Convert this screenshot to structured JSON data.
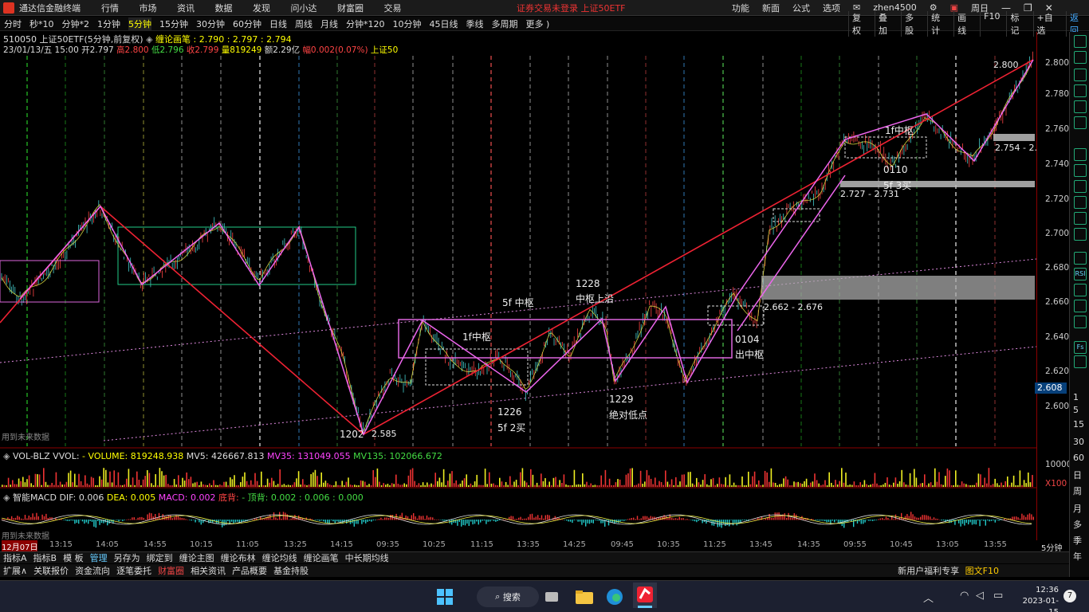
{
  "titlebar": {
    "app_name": "通达信金融终端",
    "menus": [
      "行情",
      "市场",
      "资讯",
      "数据",
      "发现",
      "问小达",
      "财富圈",
      "交易"
    ],
    "notice": "证券交易未登录  上证50ETF",
    "right_items": [
      "功能",
      "新面",
      "公式",
      "选项"
    ],
    "user": "zhen4500",
    "weekly": "周日"
  },
  "periods": [
    "分时",
    "秒*10",
    "分钟*2",
    "1分钟",
    "5分钟",
    "15分钟",
    "30分钟",
    "60分钟",
    "日线",
    "周线",
    "月线",
    "分钟*120",
    "10分钟",
    "45日线",
    "季线",
    "多周期",
    "更多 )"
  ],
  "active_period": "5分钟",
  "toolbar_right": [
    "复权",
    "叠加",
    "多股",
    "统计",
    "画线",
    "F10",
    "标记",
    "+自选",
    "返回"
  ],
  "info": {
    "line1_code": "510050 上证50ETF(5分钟,前复权)",
    "line1_indicator": "缠论画笔 : 2.790 : 2.797 : 2.794",
    "line2_date": "23/01/13/五 15:00",
    "line2_open": "开2.797",
    "line2_high": "高2.800",
    "line2_low": "低2.796",
    "line2_close": "收2.799",
    "line2_vol": "量819249",
    "line2_amt": "额2.29亿",
    "line2_chg": "幅0.002(0.07%)",
    "line2_idx": "上证50"
  },
  "annotations": {
    "a1": "1f中枢",
    "a2": "5f 中枢",
    "a3": "1228",
    "a4": "中枢上沿",
    "a5": "1226",
    "a6": "5f 2买",
    "a7": "1229",
    "a8": "绝对低点",
    "a9": "0104",
    "a10": "出中枢",
    "a11": "1f中枢",
    "a12": "0110",
    "a13": "5f 3买",
    "a14": "1202",
    "l1": "2.585",
    "l2": "2.662 - 2.676",
    "l3": "2.727 - 2.731",
    "l4": "2.754 - 2.",
    "l5": "2.800",
    "future1": "用到未来数据",
    "future2": "用到未来数据"
  },
  "price_axis": [
    "2.800",
    "2.780",
    "2.760",
    "2.740",
    "2.720",
    "2.700",
    "2.680",
    "2.660",
    "2.640",
    "2.620",
    "2.600"
  ],
  "last_price": "2.608",
  "vol_axis": [
    "10000",
    "X100"
  ],
  "vol_header": {
    "name": "VOL-BLZ VVOL:",
    "volume": "- VOLUME: 819248.938",
    "mv5": "MV5: 426667.813",
    "mv35": "MV35: 131049.055",
    "mv135": "MV135: 102066.672"
  },
  "macd_header": {
    "name": "智能MACD",
    "dif": "DIF: 0.006",
    "dea": "DEA: 0.005",
    "macd": "MACD: 0.002",
    "bot": "底背:",
    "top": "- 顶背: 0.002 : 0.006 : 0.000"
  },
  "time_axis": [
    "12月07日",
    "13:15",
    "14:05",
    "14:55",
    "10:15",
    "11:05",
    "13:25",
    "14:15",
    "09:35",
    "10:25",
    "11:15",
    "13:35",
    "14:25",
    "09:45",
    "10:35",
    "11:25",
    "13:45",
    "14:35",
    "09:55",
    "10:45",
    "13:05",
    "13:55"
  ],
  "bottom_tabs": [
    "指标A",
    "指标B",
    "模 板",
    "管理",
    "另存为",
    "绑定到",
    "缠论主图",
    "缠论布林",
    "缠论均线",
    "缠论画笔",
    "中长期均线"
  ],
  "active_tab": "管理",
  "status_tabs": [
    "扩展∧",
    "关联报价",
    "资金流向",
    "逐笔委托",
    "财富圈",
    "相关资讯",
    "产品概要",
    "基金持股"
  ],
  "promo": "新用户福利专享",
  "promo_tag": "图文F10",
  "right_tools": [
    "",
    "",
    "",
    "",
    "",
    "",
    "",
    "",
    "",
    "",
    "",
    "",
    "",
    "RSI",
    "",
    "",
    "",
    "",
    "Fs",
    "",
    "",
    "",
    "",
    "",
    ""
  ],
  "right_words": [
    "1",
    "5",
    "15",
    "30",
    "60",
    "日",
    "周",
    "月",
    "多",
    "季",
    "年"
  ],
  "right_bottom": "5分钟",
  "taskbar": {
    "search": "搜索",
    "time": "12:36",
    "date": "2023-01-15",
    "badge": "7"
  }
}
